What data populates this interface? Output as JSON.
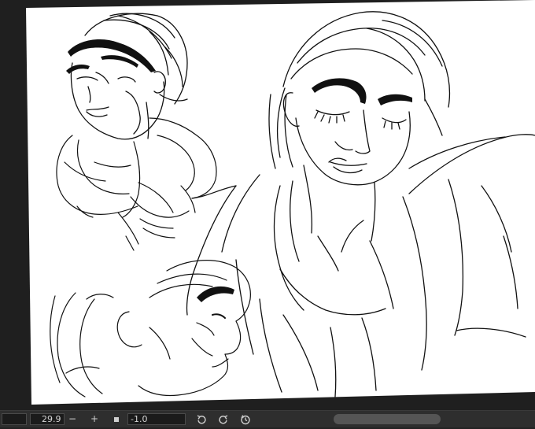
{
  "statusbar": {
    "zoom_value": "29.9",
    "zoom_out_label": "−",
    "zoom_in_label": "+",
    "rotation_value": "-1.0",
    "icons": [
      "stop-square-icon",
      "rotate-left-icon",
      "rotate-right-icon",
      "reset-rotation-icon"
    ]
  },
  "colors": {
    "paper": "#ffffff",
    "ink": "#111111",
    "workspace": "#1f1f1f",
    "statusbar": "#2e2e2e"
  }
}
